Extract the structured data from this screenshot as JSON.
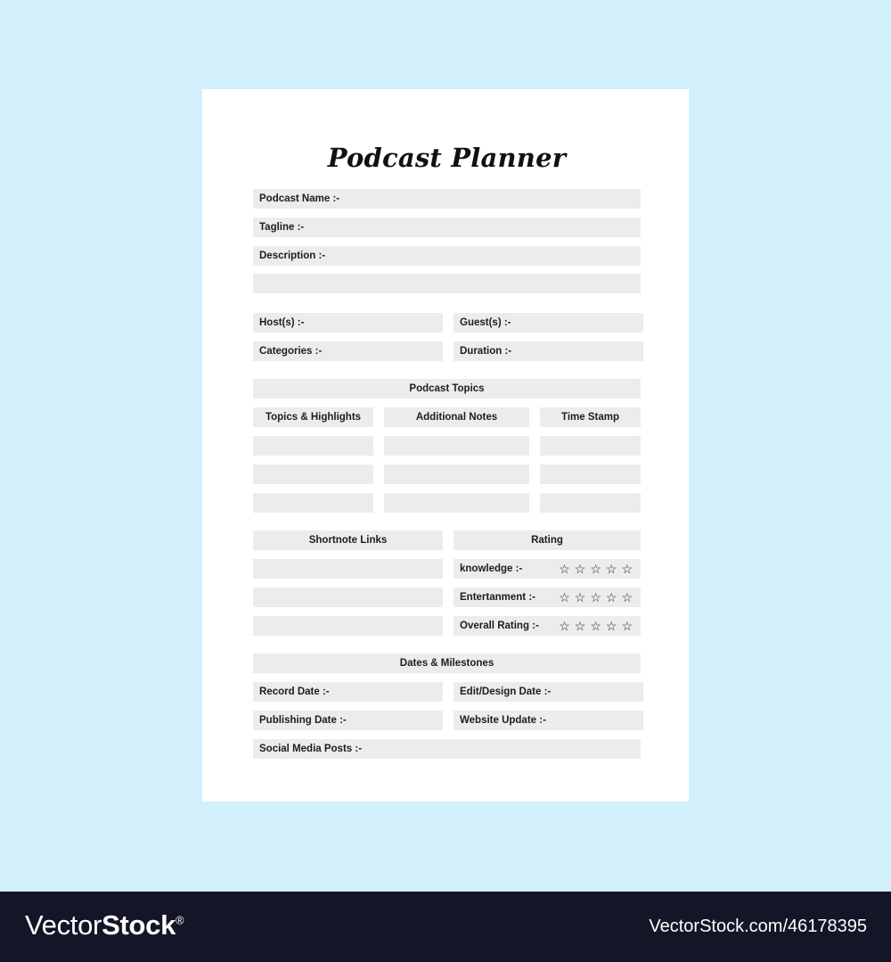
{
  "page": {
    "title": "Podcast Planner",
    "background_color": "#d2f0fb",
    "card_color": "#ffffff",
    "field_color": "#ececec",
    "text_color": "#1d1d1d"
  },
  "fields": {
    "podcast_name": "Podcast Name :-",
    "tagline": "Tagline :-",
    "description": "Description :-",
    "description_blank": "",
    "hosts": "Host(s) :-",
    "guests": "Guest(s) :-",
    "categories": "Categories :-",
    "duration": "Duration :-"
  },
  "topics_section": {
    "heading": "Podcast Topics",
    "columns": [
      {
        "header": "Topics & Highlights",
        "rows": [
          "",
          "",
          ""
        ]
      },
      {
        "header": "Additional Notes",
        "rows": [
          "",
          "",
          ""
        ]
      },
      {
        "header": "Time Stamp",
        "rows": [
          "",
          "",
          ""
        ]
      }
    ]
  },
  "shortnote_section": {
    "heading": "Shortnote Links",
    "rows": [
      "",
      "",
      ""
    ]
  },
  "rating_section": {
    "heading": "Rating",
    "star_glyph": "☆",
    "star_count": 5,
    "rows": [
      {
        "label": "knowledge :-",
        "stars": 0
      },
      {
        "label": "Entertanment :-",
        "stars": 0
      },
      {
        "label": "Overall Rating :-",
        "stars": 0
      }
    ]
  },
  "dates_section": {
    "heading": "Dates & Milestones",
    "record_date": "Record Date :-",
    "edit_design_date": "Edit/Design Date :-",
    "publishing_date": "Publishing Date :-",
    "website_update": "Website Update :-",
    "social_media_posts": "Social Media Posts :-"
  },
  "footer": {
    "brand_light": "Vector",
    "brand_bold": "Stock",
    "brand_registered": "®",
    "url": "VectorStock.com/46178395"
  }
}
